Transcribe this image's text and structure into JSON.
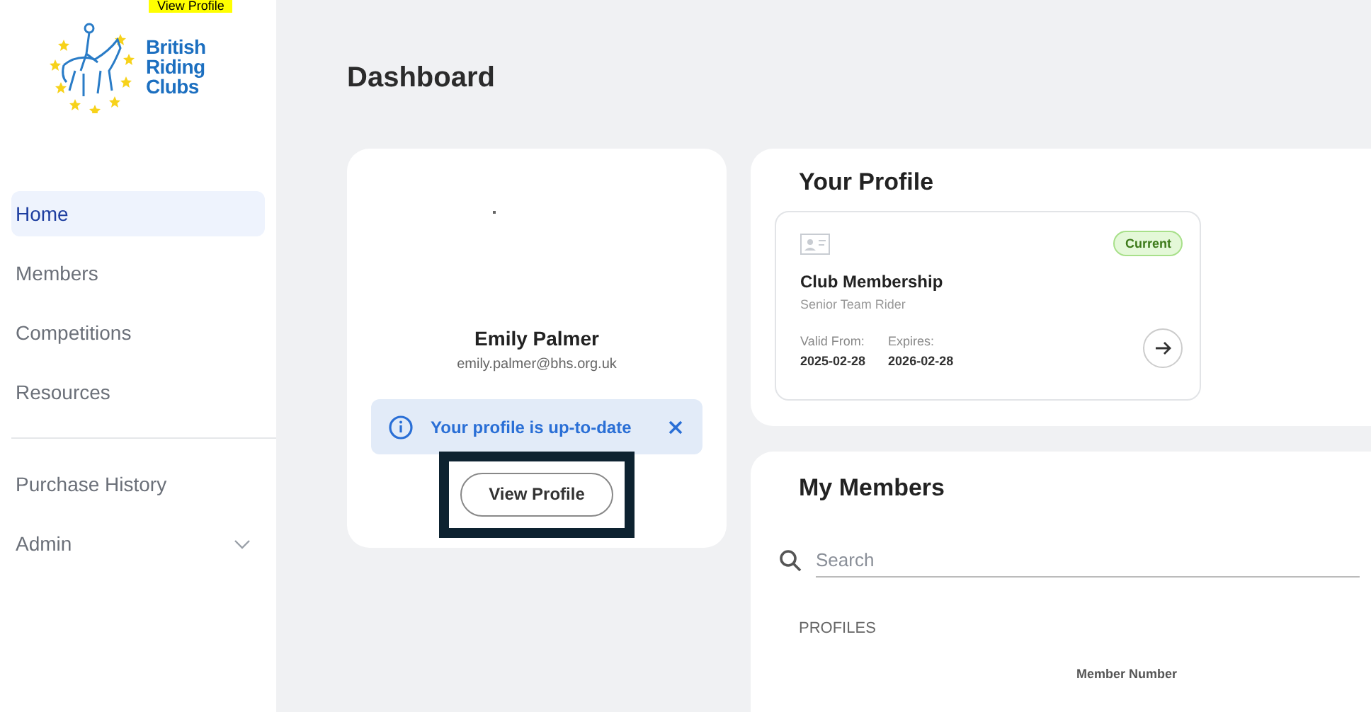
{
  "annotation": {
    "label": "View Profile"
  },
  "logo": {
    "text": "British Riding Clubs"
  },
  "sidebar": {
    "sections": [
      {
        "items": [
          {
            "label": "Home",
            "selected": true
          },
          {
            "label": "Members",
            "selected": false
          },
          {
            "label": "Competitions",
            "selected": false
          },
          {
            "label": "Resources",
            "selected": false
          }
        ]
      },
      {
        "items": [
          {
            "label": "Purchase History",
            "selected": false
          },
          {
            "label": "Admin",
            "selected": false,
            "expanded": false
          }
        ]
      }
    ]
  },
  "page": {
    "title": "Dashboard"
  },
  "profile_card": {
    "name": "Emily Palmer",
    "email": "emily.palmer@bhs.org.uk",
    "notice": {
      "text": "Your profile is up-to-date"
    },
    "button": "View Profile",
    "button_highlighted": true
  },
  "your_profile": {
    "title": "Your Profile",
    "membership": {
      "status": "Current",
      "title": "Club Membership",
      "subtitle": "Senior Team Rider",
      "valid_from_label": "Valid From:",
      "valid_from": "2025-02-28",
      "expires_label": "Expires:",
      "expires": "2026-02-28"
    }
  },
  "my_members": {
    "title": "My Members",
    "search": {
      "placeholder": "Search"
    },
    "section_label": "PROFILES",
    "table": {
      "columns": [
        "Member Number"
      ]
    }
  }
}
